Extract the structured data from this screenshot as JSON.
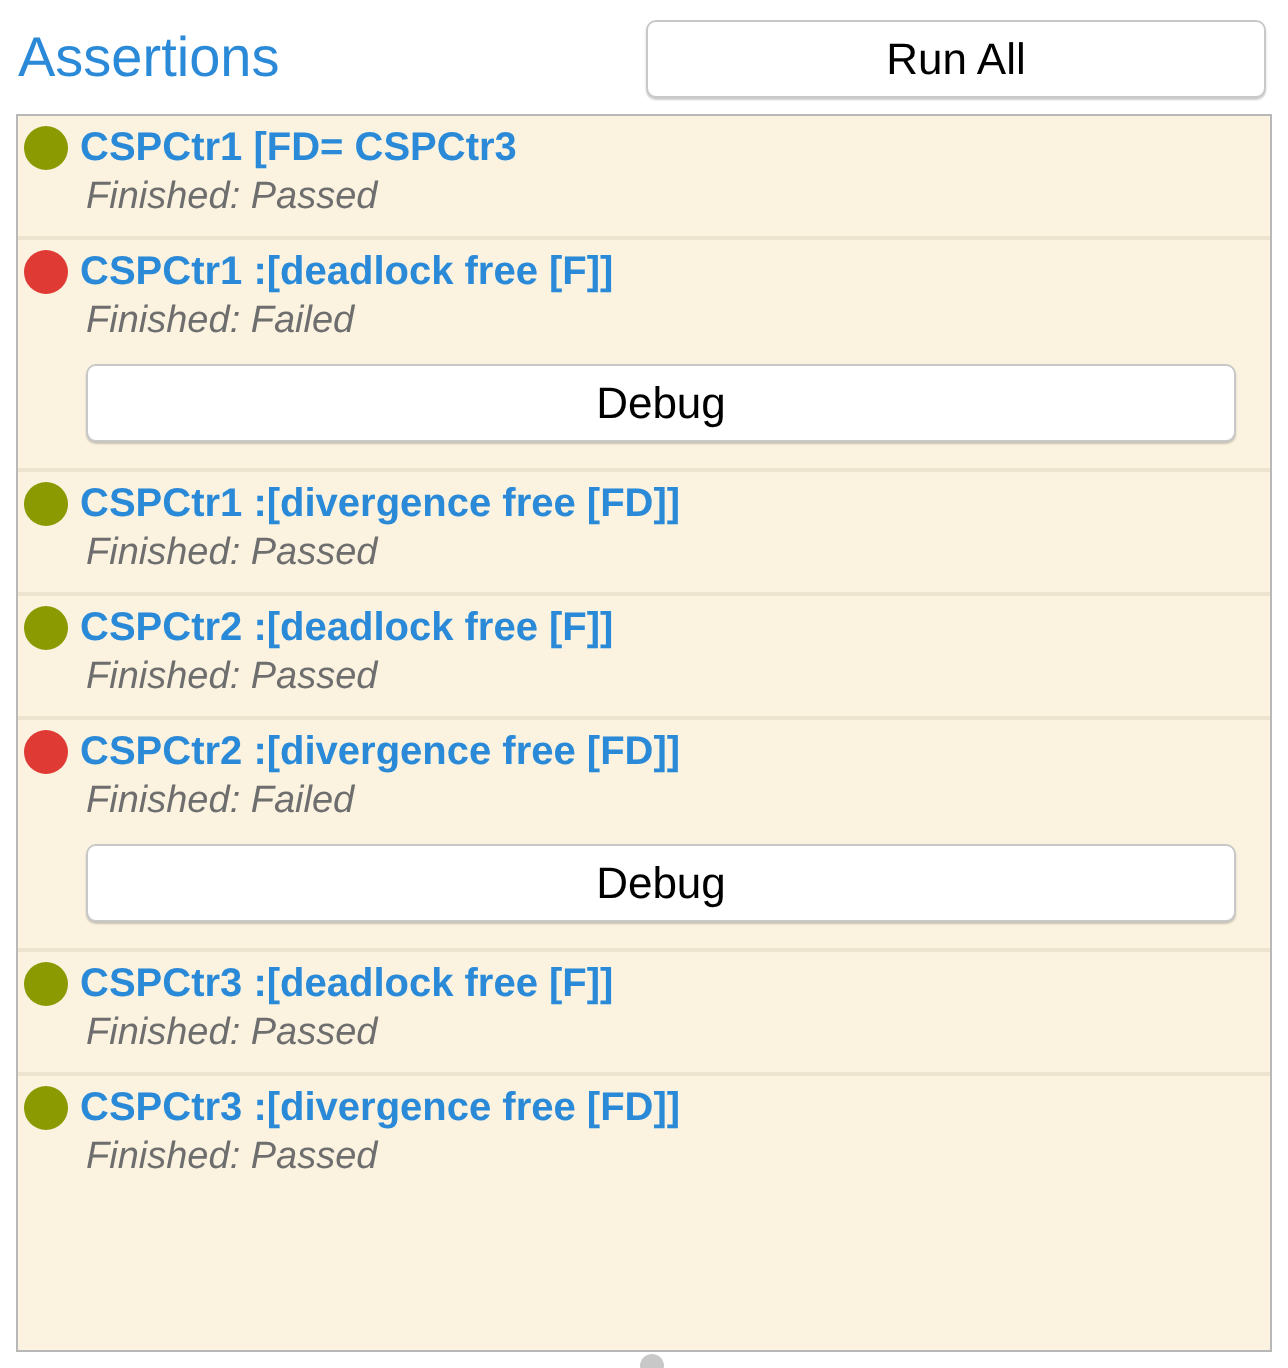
{
  "title": "Assertions",
  "run_all_button": "Run All",
  "assertions": [
    {
      "name": "CSPCtr1 [FD= CSPCtr3",
      "status": "Finished: Passed",
      "color": "#8a9a00"
    },
    {
      "name": "CSPCtr1 :[deadlock free [F]]",
      "status": "Finished: Failed",
      "color": "#e03a35",
      "debug_button": "Debug"
    },
    {
      "name": "CSPCtr1 :[divergence free [FD]]",
      "status": "Finished: Passed",
      "color": "#8a9a00"
    },
    {
      "name": "CSPCtr2 :[deadlock free [F]]",
      "status": "Finished: Passed",
      "color": "#8a9a00"
    },
    {
      "name": "CSPCtr2 :[divergence free [FD]]",
      "status": "Finished: Failed",
      "color": "#e03a35",
      "debug_button": "Debug"
    },
    {
      "name": "CSPCtr3 :[deadlock free [F]]",
      "status": "Finished: Passed",
      "color": "#8a9a00"
    },
    {
      "name": "CSPCtr3 :[divergence free [FD]]",
      "status": "Finished: Passed",
      "color": "#8a9a00"
    }
  ]
}
